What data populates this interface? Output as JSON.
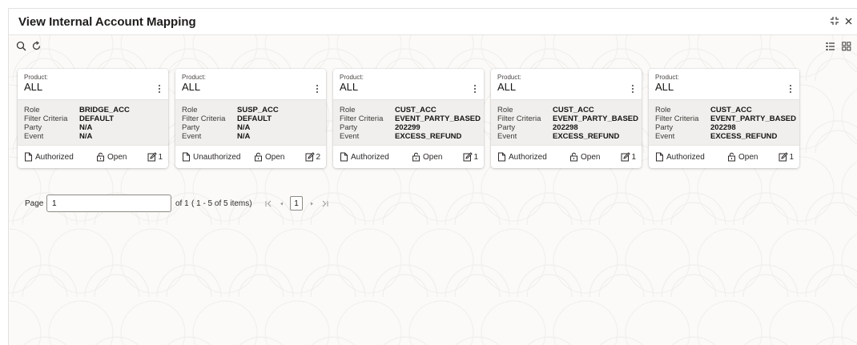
{
  "window": {
    "title": "View Internal Account Mapping"
  },
  "toolbar": {
    "search_icon": "search-icon",
    "refresh_icon": "refresh-icon",
    "list_view_icon": "list-view-icon",
    "grid_view_icon": "grid-view-icon"
  },
  "card_labels": {
    "product": "Product:",
    "role": "Role",
    "filter_criteria": "Filter Criteria",
    "party": "Party",
    "event": "Event"
  },
  "cards": [
    {
      "product": "ALL",
      "role": "BRIDGE_ACC",
      "filter_criteria": "DEFAULT",
      "party": "N/A",
      "event": "N/A",
      "status": "Authorized",
      "lock": "Open",
      "mods": "1"
    },
    {
      "product": "ALL",
      "role": "SUSP_ACC",
      "filter_criteria": "DEFAULT",
      "party": "N/A",
      "event": "N/A",
      "status": "Unauthorized",
      "lock": "Open",
      "mods": "2"
    },
    {
      "product": "ALL",
      "role": "CUST_ACC",
      "filter_criteria": "EVENT_PARTY_BASED",
      "party": "202299",
      "event": "EXCESS_REFUND",
      "status": "Authorized",
      "lock": "Open",
      "mods": "1"
    },
    {
      "product": "ALL",
      "role": "CUST_ACC",
      "filter_criteria": "EVENT_PARTY_BASED",
      "party": "202298",
      "event": "EXCESS_REFUND",
      "status": "Authorized",
      "lock": "Open",
      "mods": "1"
    },
    {
      "product": "ALL",
      "role": "CUST_ACC",
      "filter_criteria": "EVENT_PARTY_BASED",
      "party": "202298",
      "event": "EXCESS_REFUND",
      "status": "Authorized",
      "lock": "Open",
      "mods": "1"
    }
  ],
  "pagination": {
    "page_label": "Page",
    "page_value": "1",
    "of_label": "of 1",
    "items_label": "( 1 - 5 of 5 items)",
    "current_page": "1"
  },
  "colors": {
    "frame_bg": "#fbfaf8",
    "card_body": "#f1efed",
    "text": "#161513"
  }
}
